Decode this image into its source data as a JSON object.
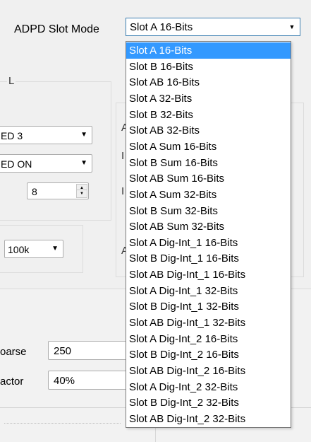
{
  "slot_mode": {
    "label": "ADPD Slot Mode",
    "selected": "Slot A 16-Bits",
    "options": [
      "Slot A 16-Bits",
      "Slot B 16-Bits",
      "Slot AB 16-Bits",
      "Slot A 32-Bits",
      "Slot B 32-Bits",
      "Slot AB 32-Bits",
      "Slot A Sum 16-Bits",
      "Slot B Sum 16-Bits",
      "Slot AB Sum 16-Bits",
      "Slot A Sum 32-Bits",
      "Slot B Sum 32-Bits",
      "Slot AB Sum 32-Bits",
      "Slot A Dig-Int_1 16-Bits",
      "Slot B Dig-Int_1 16-Bits",
      "Slot AB Dig-Int_1 16-Bits",
      "Slot A Dig-Int_1 32-Bits",
      "Slot B Dig-Int_1 32-Bits",
      "Slot AB Dig-Int_1 32-Bits",
      "Slot A Dig-Int_2 16-Bits",
      "Slot B Dig-Int_2 16-Bits",
      "Slot AB Dig-Int_2 16-Bits",
      "Slot A Dig-Int_2 32-Bits",
      "Slot B Dig-Int_2 32-Bits",
      "Slot AB Dig-Int_2 32-Bits"
    ],
    "highlighted_index": 0
  },
  "group_title_fragment": "L",
  "led_select_1": "ED 3",
  "led_select_2": "ED ON",
  "spin_value": "8",
  "freq_select": "100k",
  "right_group_fragments": [
    "A",
    "I",
    "I",
    "A"
  ],
  "coarse": {
    "label": "oarse",
    "value": "250"
  },
  "factor": {
    "label": "actor",
    "value": "40%"
  }
}
